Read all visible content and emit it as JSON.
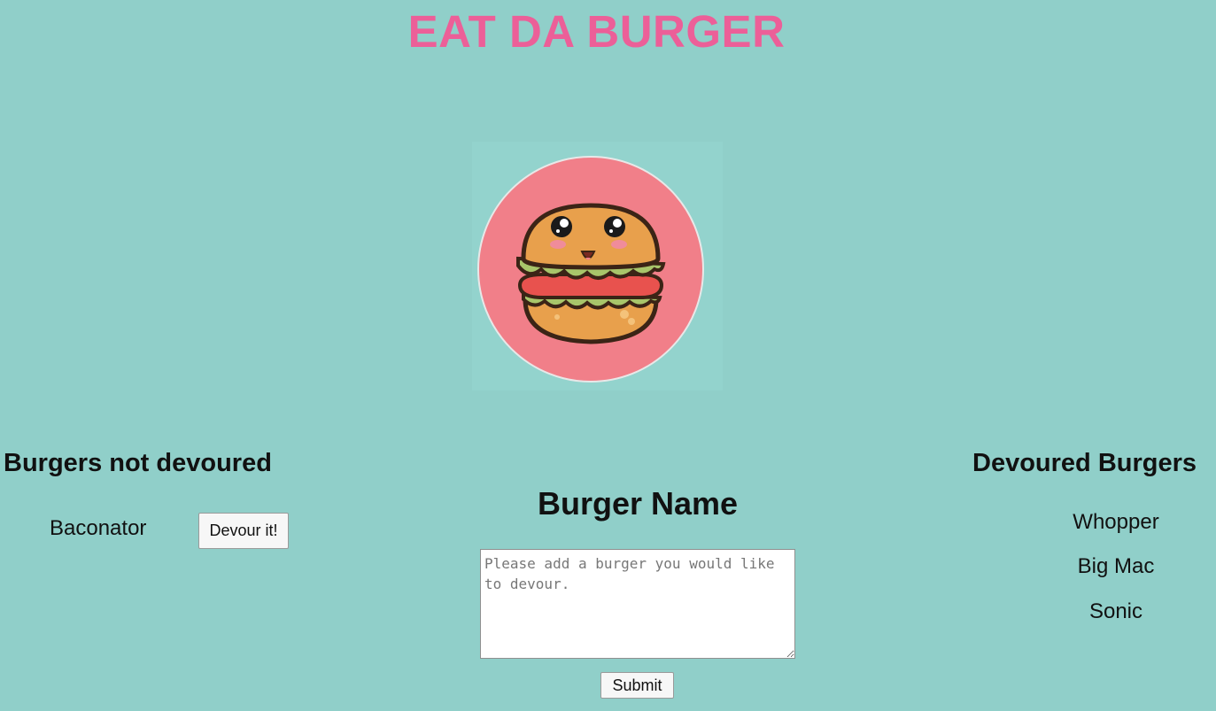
{
  "header": {
    "title": "EAT DA BURGER"
  },
  "logo": {
    "icon": "kawaii-burger-icon",
    "circle_color": "#f17f89"
  },
  "not_devoured": {
    "heading": "Burgers not devoured",
    "items": [
      {
        "name": "Baconator",
        "button_label": "Devour it!"
      }
    ]
  },
  "form": {
    "heading": "Burger Name",
    "placeholder": "Please add a burger you would like to devour.",
    "value": "",
    "submit_label": "Submit"
  },
  "devoured": {
    "heading": "Devoured Burgers",
    "items": [
      "Whopper",
      "Big Mac",
      "Sonic"
    ]
  },
  "colors": {
    "background": "#90cfc9",
    "title": "#ec5f98"
  }
}
